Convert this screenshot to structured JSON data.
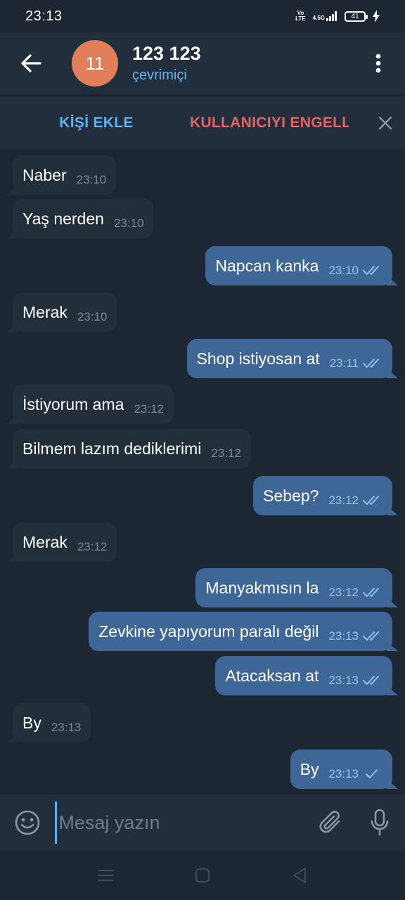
{
  "status_bar": {
    "time": "23:13",
    "volte_top": "Vo",
    "volte_bottom": "LTE",
    "network": "4.5G",
    "battery": "41"
  },
  "header": {
    "avatar_text": "11",
    "avatar_color": "#e17f5a",
    "title": "123 123",
    "status": "çevrimiçi"
  },
  "action_bar": {
    "add_contact": "KİŞİ EKLE",
    "block_user": "KULLANICIYI ENGELLE"
  },
  "messages": [
    {
      "direction": "in",
      "text": "Naber",
      "time": "23:10"
    },
    {
      "direction": "in",
      "text": "Yaş nerden",
      "time": "23:10"
    },
    {
      "direction": "out",
      "text": "Napcan kanka",
      "time": "23:10",
      "status": "read"
    },
    {
      "direction": "in",
      "text": "Merak",
      "time": "23:10"
    },
    {
      "direction": "out",
      "text": "Shop istiyosan at",
      "time": "23:11",
      "status": "read"
    },
    {
      "direction": "in",
      "text": "İstiyorum ama",
      "time": "23:12"
    },
    {
      "direction": "in",
      "text": "Bilmem lazım dediklerimi",
      "time": "23:12"
    },
    {
      "direction": "out",
      "text": "Sebep?",
      "time": "23:12",
      "status": "read"
    },
    {
      "direction": "in",
      "text": "Merak",
      "time": "23:12"
    },
    {
      "direction": "out",
      "text": "Manyakmısın la",
      "time": "23:12",
      "status": "read"
    },
    {
      "direction": "out",
      "text": "Zevkine yapıyorum paralı değil",
      "time": "23:13",
      "status": "read"
    },
    {
      "direction": "out",
      "text": "Atacaksan at",
      "time": "23:13",
      "status": "read"
    },
    {
      "direction": "in",
      "text": "By",
      "time": "23:13"
    },
    {
      "direction": "out",
      "text": "By",
      "time": "23:13",
      "status": "sent"
    }
  ],
  "composer": {
    "placeholder": "Mesaj yazın",
    "value": ""
  },
  "icons": {
    "back": "arrow-left-icon",
    "menu": "more-vertical-icon",
    "close": "close-icon",
    "emoji": "smile-icon",
    "attach": "paperclip-icon",
    "mic": "microphone-icon"
  },
  "colors": {
    "background": "#1d2733",
    "header": "#232e3c",
    "incoming_bubble": "#222e3a",
    "outgoing_bubble": "#3e6696",
    "accent": "#5fb0ed",
    "danger": "#e26466"
  }
}
